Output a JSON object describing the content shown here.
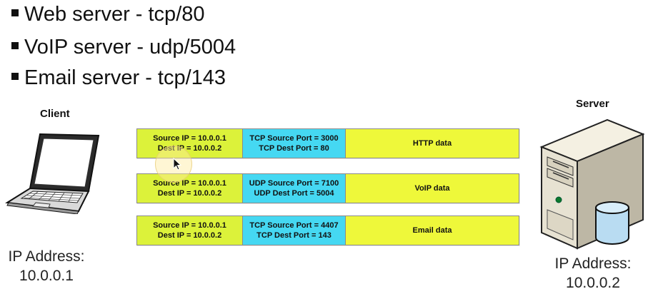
{
  "bullets": [
    "Web server - tcp/80",
    "VoIP server - udp/5004",
    "Email server - tcp/143"
  ],
  "client": {
    "title": "Client",
    "ip_label": "IP Address:",
    "ip_value": "10.0.0.1"
  },
  "server": {
    "title": "Server",
    "ip_label": "IP Address:",
    "ip_value": "10.0.0.2"
  },
  "packets": [
    {
      "source_ip": "Source IP = 10.0.0.1",
      "dest_ip": "Dest IP = 10.0.0.2",
      "source_port": "TCP Source Port = 3000",
      "dest_port": "TCP Dest Port = 80",
      "data": "HTTP data"
    },
    {
      "source_ip": "Source IP = 10.0.0.1",
      "dest_ip": "Dest IP = 10.0.0.2",
      "source_port": "UDP Source Port = 7100",
      "dest_port": "UDP Dest Port = 5004",
      "data": "VoIP data"
    },
    {
      "source_ip": "Source IP = 10.0.0.1",
      "dest_ip": "Dest IP = 10.0.0.2",
      "source_port": "TCP Source Port = 4407",
      "dest_port": "TCP Dest Port = 143",
      "data": "Email data"
    }
  ],
  "colors": {
    "ip_cell": "#dcf23a",
    "port_cell": "#45d8f2",
    "data_cell": "#eef83a"
  },
  "icons": {
    "client": "laptop-icon",
    "server": "server-tower-icon",
    "database": "database-icon",
    "pointer": "mouse-pointer-icon"
  }
}
